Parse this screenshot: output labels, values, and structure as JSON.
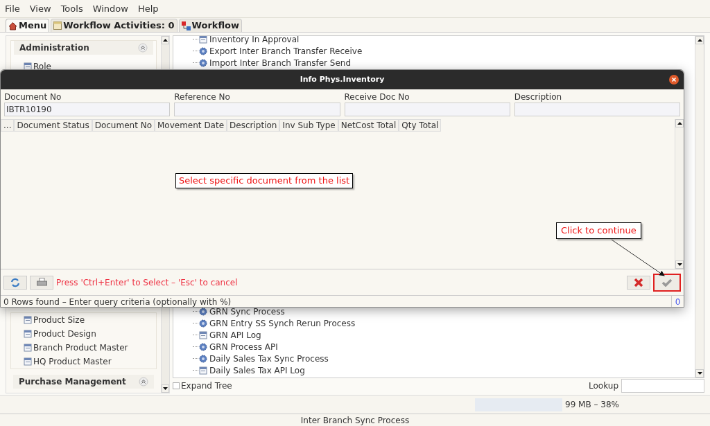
{
  "menu_bar": [
    "File",
    "View",
    "Tools",
    "Window",
    "Help"
  ],
  "tabs": [
    {
      "label": "Menu",
      "kind": "home",
      "selected": true
    },
    {
      "label": "Workflow Activities: 0",
      "kind": "calendar",
      "selected": false
    },
    {
      "label": "Workflow",
      "kind": "workflow",
      "selected": false
    }
  ],
  "sidebar": {
    "upper": [
      {
        "kind": "header",
        "label": "Administration"
      },
      {
        "kind": "item",
        "label": "Role"
      }
    ],
    "lower": [
      {
        "kind": "item",
        "label": "Product Size"
      },
      {
        "kind": "item",
        "label": "Product Design"
      },
      {
        "kind": "item",
        "label": "Branch Product Master"
      },
      {
        "kind": "item",
        "label": "HQ Product Master"
      },
      {
        "kind": "header",
        "label": "Purchase Management"
      }
    ]
  },
  "tree": {
    "upper": [
      {
        "kind": "window",
        "label": "Inventory In Approval"
      },
      {
        "kind": "process",
        "label": "Export Inter Branch Transfer Receive"
      },
      {
        "kind": "process",
        "label": "Import Inter Branch Transfer Send"
      }
    ],
    "lower": [
      {
        "kind": "process",
        "label": "GRN Sync Process"
      },
      {
        "kind": "process",
        "label": "GRN Entry SS Synch Rerun Process"
      },
      {
        "kind": "window",
        "label": "GRN API Log"
      },
      {
        "kind": "process",
        "label": "GRN Process API"
      },
      {
        "kind": "process",
        "label": "Daily Sales Tax Sync Process"
      },
      {
        "kind": "window",
        "label": "Daily Sales Tax API Log"
      }
    ]
  },
  "expand_tree": {
    "label": "Expand Tree",
    "checked": false
  },
  "lookup": {
    "label": "Lookup"
  },
  "memory": "99 MB – 38%",
  "status_bar": "Inter Branch Sync Process",
  "dialog": {
    "title": "Info Phys.Inventory",
    "fields": [
      {
        "label": "Document No",
        "value": "IBTR10190"
      },
      {
        "label": "Reference No"
      },
      {
        "label": "Receive Doc No"
      },
      {
        "label": "Description"
      }
    ],
    "columns": [
      "...",
      "Document Status",
      "Document No",
      "Movement Date",
      "Description",
      "Inv Sub Type",
      "NetCost Total",
      "Qty Total"
    ],
    "hint": "Press 'Ctrl+Enter' to Select – 'Esc' to cancel",
    "status": "0 Rows found – Enter query criteria (optionally with %)",
    "count": "0"
  },
  "annotations": [
    "Select specific document from the list",
    "Click to continue"
  ]
}
